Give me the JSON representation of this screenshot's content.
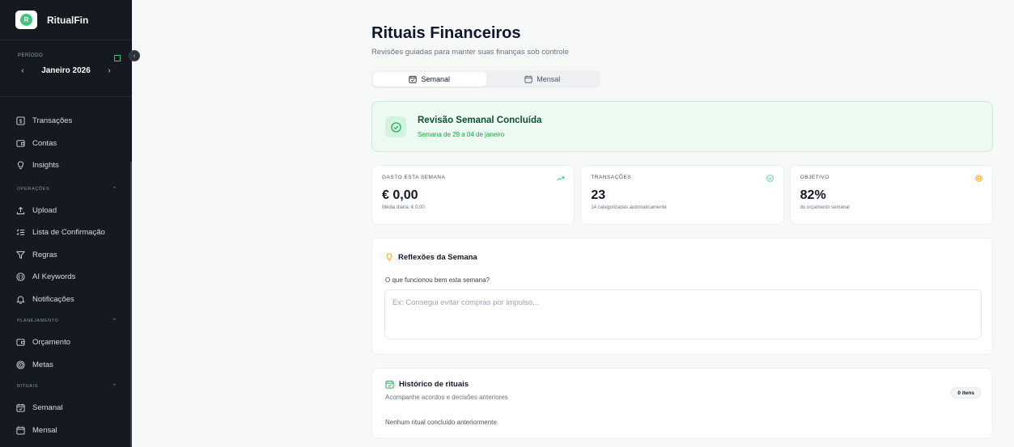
{
  "app": {
    "name": "RitualFin",
    "logo_letter": "R",
    "accent": "#3ec87a"
  },
  "period": {
    "label": "PERÍODO",
    "month": "Janeiro 2026",
    "prev_icon": "chevron-left-icon",
    "next_icon": "chevron-right-icon"
  },
  "sidebar": {
    "main_items": [
      {
        "label": "Transações",
        "icon": "dollar-square-icon"
      },
      {
        "label": "Contas",
        "icon": "wallet-icon"
      },
      {
        "label": "Insights",
        "icon": "lightbulb-icon"
      }
    ],
    "sections": [
      {
        "label": "OPERAÇÕES",
        "items": [
          {
            "label": "Upload",
            "icon": "upload-icon"
          },
          {
            "label": "Lista de Confirmação",
            "icon": "list-check-icon"
          },
          {
            "label": "Regras",
            "icon": "filter-icon"
          },
          {
            "label": "AI Keywords",
            "icon": "braces-icon"
          },
          {
            "label": "Notificações",
            "icon": "bell-icon"
          }
        ]
      },
      {
        "label": "PLANEJAMENTO",
        "items": [
          {
            "label": "Orçamento",
            "icon": "wallet-icon"
          },
          {
            "label": "Metas",
            "icon": "target-icon"
          }
        ]
      },
      {
        "label": "RITUAIS",
        "items": [
          {
            "label": "Semanal",
            "icon": "calendar-check-icon"
          },
          {
            "label": "Mensal",
            "icon": "calendar-icon"
          }
        ]
      }
    ]
  },
  "page": {
    "title": "Rituais Financeiros",
    "subtitle": "Revisões guiadas para manter suas finanças sob controle"
  },
  "tabs": [
    {
      "label": "Semanal",
      "active": true
    },
    {
      "label": "Mensal",
      "active": false
    }
  ],
  "completion": {
    "title": "Revisão Semanal Concluída",
    "subtitle": "Semana de 29 a 04 de janeiro"
  },
  "stats": [
    {
      "label": "GASTO ESTA SEMANA",
      "value": "€ 0,00",
      "sub": "Média diária: € 0,00",
      "icon": "trending-up-icon",
      "color": "#3ec87a"
    },
    {
      "label": "TRANSAÇÕES",
      "value": "23",
      "sub": "14 categorizadas automaticamente",
      "icon": "check-circle-icon",
      "color": "#3ec87a"
    },
    {
      "label": "OBJETIVO",
      "value": "82%",
      "sub": "do orçamento semanal",
      "icon": "target-icon",
      "color": "#f59e0b"
    }
  ],
  "reflections": {
    "title": "Reflexões da Semana",
    "question": "O que funcionou bem esta semana?",
    "placeholder": "Ex: Consegui evitar compras por impulso..."
  },
  "history": {
    "title": "Histórico de rituais",
    "subtitle": "Acompanhe acordos e decisões anteriores",
    "badge": "0 itens",
    "empty": "Nenhum ritual concluído anteriormente."
  }
}
